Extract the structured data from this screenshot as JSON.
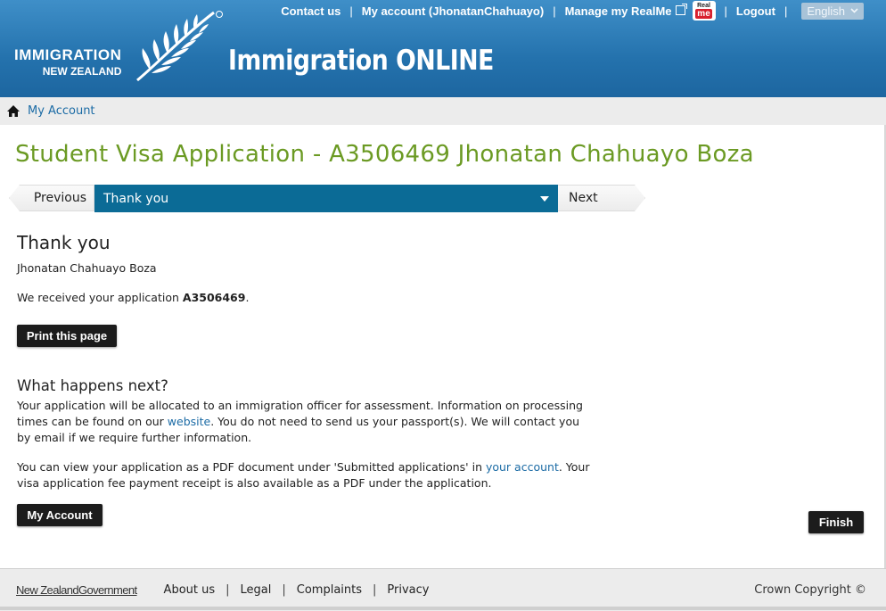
{
  "header": {
    "logo_line1": "IMMIGRATION",
    "logo_line2": "NEW ZEALAND",
    "app_title": "Immigration ONLINE",
    "nav": {
      "contact": "Contact us",
      "account": "My account (JhonatanChahuayo)",
      "manage": "Manage my RealMe",
      "realme_top": "Real",
      "realme_bottom": "me",
      "logout": "Logout",
      "language": "English",
      "sep": "|"
    }
  },
  "breadcrumb": {
    "label": "My Account"
  },
  "main": {
    "title": "Student Visa Application - A3506469 Jhonatan Chahuayo Boza",
    "stepper": {
      "previous": "Previous",
      "current": "Thank you",
      "next": "Next"
    },
    "heading": "Thank you",
    "applicant": "Jhonatan Chahuayo Boza",
    "received_prefix": "We received your application ",
    "application_number": "A3506469",
    "received_suffix": ".",
    "print_button": "Print this page",
    "next_heading": "What happens next?",
    "para1_a": "Your application will be allocated to an immigration officer for assessment. Information on processing times can be found on our ",
    "para1_link": "website",
    "para1_b": ". You do not need to send us your passport(s). We will contact you by email if we require further information.",
    "para2_a": "You can view your application as a PDF document under 'Submitted applications' in ",
    "para2_link": "your account",
    "para2_b": ". Your visa application fee payment receipt is also available as a PDF under the application.",
    "my_account_button": "My Account",
    "finish_button": "Finish"
  },
  "footer": {
    "gov_logo_a": "New Zealand",
    "gov_logo_b": "Government",
    "links": [
      "About us",
      "Legal",
      "Complaints",
      "Privacy"
    ],
    "sep": "|",
    "copyright": "Crown Copyright ©"
  },
  "colors": {
    "header_blue": "#2472ad",
    "title_green": "#6b9a23",
    "step_blue": "#0b6b96"
  }
}
